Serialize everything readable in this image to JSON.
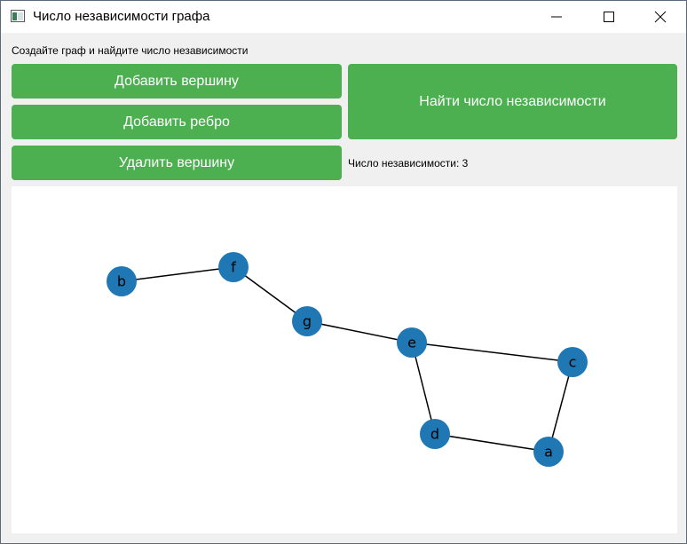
{
  "window": {
    "title": "Число независимости графа"
  },
  "instructions": "Создайте граф и найдите число независимости",
  "buttons": {
    "add_vertex": "Добавить вершину",
    "add_edge": "Добавить ребро",
    "delete_vertex": "Удалить вершину",
    "find_independence": "Найти число независимости"
  },
  "result_label": "Число независимости: 3",
  "colors": {
    "button": "#4caf50",
    "node": "#1f77b4",
    "edge": "#000000"
  },
  "graph": {
    "nodes": [
      "b",
      "f",
      "g",
      "e",
      "c",
      "d",
      "a"
    ],
    "edges": [
      [
        "b",
        "f"
      ],
      [
        "f",
        "g"
      ],
      [
        "g",
        "e"
      ],
      [
        "e",
        "c"
      ],
      [
        "e",
        "d"
      ],
      [
        "d",
        "a"
      ],
      [
        "a",
        "c"
      ]
    ]
  }
}
